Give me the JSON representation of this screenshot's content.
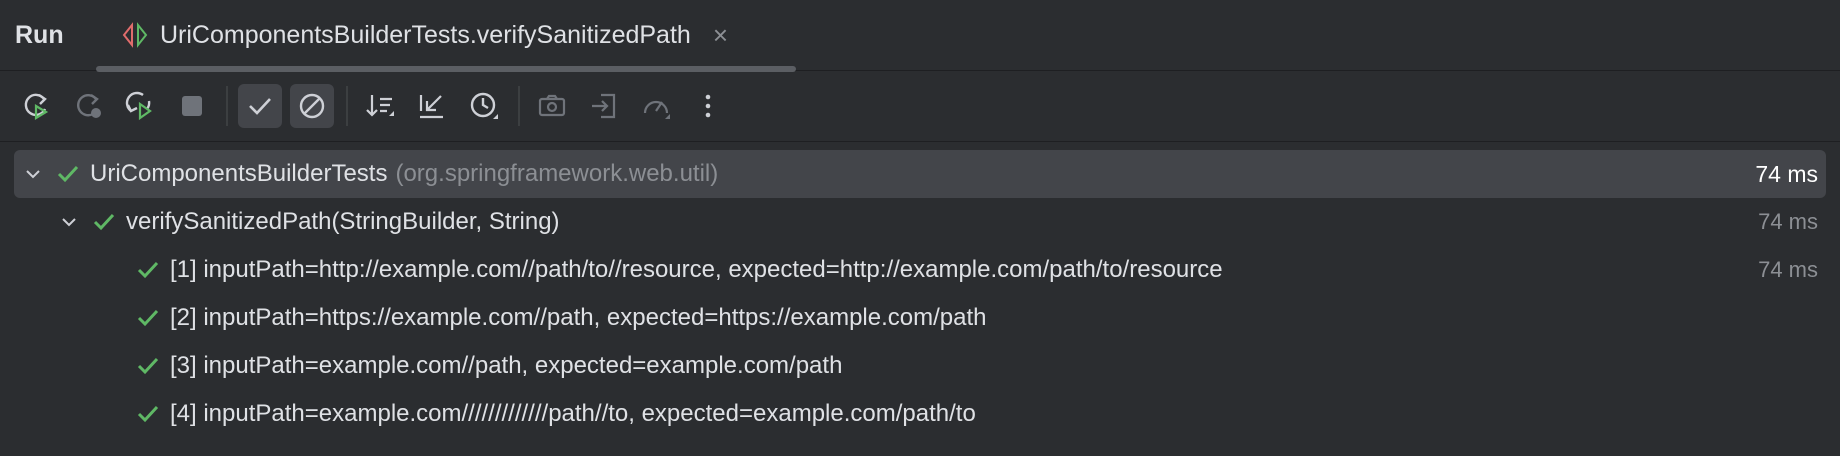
{
  "header": {
    "panel_title": "Run",
    "tab_label": "UriComponentsBuilderTests.verifySanitizedPath",
    "tab_close": "×"
  },
  "toolbar": {
    "buttons": [
      {
        "name": "rerun-button",
        "icon": "rerun-icon"
      },
      {
        "name": "rerun-failed-button",
        "icon": "rerun-failed-icon"
      },
      {
        "name": "toggle-auto-test-button",
        "icon": "auto-rerun-icon"
      },
      {
        "name": "stop-button",
        "icon": "stop-icon"
      },
      {
        "name": "show-passed-toggle",
        "icon": "check-icon"
      },
      {
        "name": "show-ignored-toggle",
        "icon": "ignored-icon"
      },
      {
        "name": "sort-alphabetically-button",
        "icon": "sort-icon"
      },
      {
        "name": "collapse-all-button",
        "icon": "collapse-icon"
      },
      {
        "name": "sort-by-duration-button",
        "icon": "clock-icon"
      },
      {
        "name": "screenshot-button",
        "icon": "camera-icon"
      },
      {
        "name": "import-tests-button",
        "icon": "import-icon"
      },
      {
        "name": "coverage-button",
        "icon": "gauge-icon"
      },
      {
        "name": "more-options-button",
        "icon": "more-vertical-icon"
      }
    ]
  },
  "tree": {
    "root": {
      "name": "UriComponentsBuilderTests",
      "package": "(org.springframework.web.util)",
      "duration": "74 ms"
    },
    "method": {
      "name": "verifySanitizedPath(StringBuilder, String)",
      "duration": "74 ms"
    },
    "cases": [
      {
        "label": "[1] inputPath=http://example.com//path/to//resource, expected=http://example.com/path/to/resource",
        "duration": "74 ms"
      },
      {
        "label": "[2] inputPath=https://example.com//path, expected=https://example.com/path",
        "duration": ""
      },
      {
        "label": "[3] inputPath=example.com//path, expected=example.com/path",
        "duration": ""
      },
      {
        "label": "[4] inputPath=example.com/////////////path//to, expected=example.com/path/to",
        "duration": ""
      }
    ]
  },
  "colors": {
    "background": "#2b2d30",
    "selected_row": "#43454a",
    "success_green": "#5fb865",
    "muted_text": "#8c8f94",
    "text": "#dfe1e5"
  }
}
